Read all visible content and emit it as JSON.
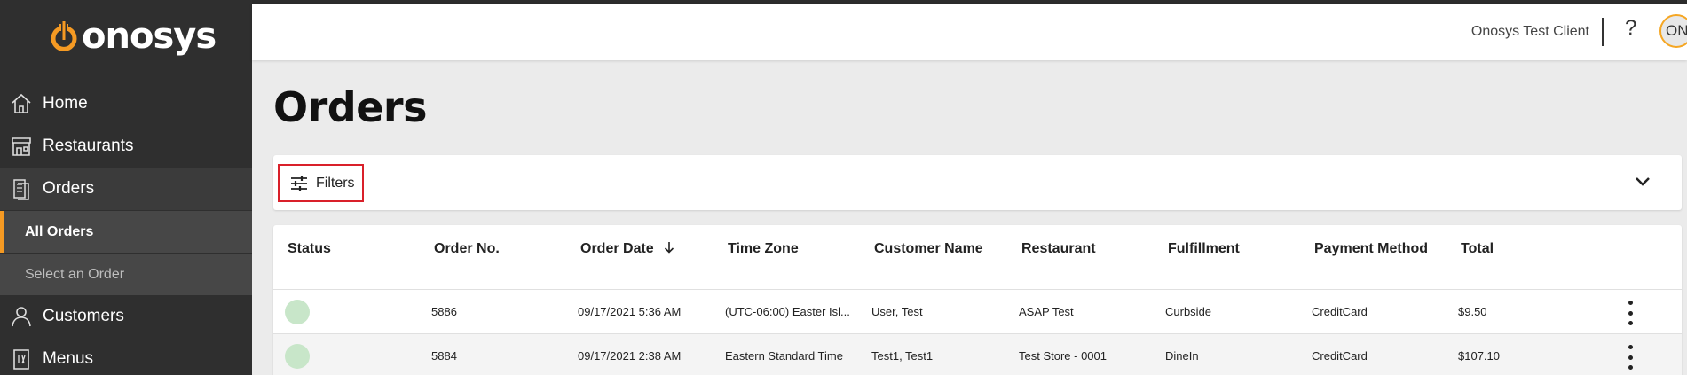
{
  "app": {
    "logo_text": "onosys",
    "brand_color": "#f59a23"
  },
  "sidebar": {
    "items": [
      {
        "label": "Home",
        "icon": "home-icon"
      },
      {
        "label": "Restaurants",
        "icon": "storefront-icon"
      },
      {
        "label": "Orders",
        "icon": "receipt-icon"
      },
      {
        "label": "Customers",
        "icon": "person-icon"
      },
      {
        "label": "Menus",
        "icon": "menu-card-icon"
      }
    ],
    "sub_items": [
      {
        "label": "All Orders"
      },
      {
        "label": "Select an Order"
      }
    ]
  },
  "header": {
    "client_name": "Onosys Test Client",
    "help_label": "?",
    "avatar_initials": "ON"
  },
  "main": {
    "title": "Orders",
    "filters_label": "Filters",
    "table": {
      "columns": [
        "Status",
        "Order No.",
        "Order Date",
        "Time Zone",
        "Customer Name",
        "Restaurant",
        "Fulfillment",
        "Payment Method",
        "Total"
      ],
      "sort_column": "Order Date",
      "sort_direction": "descending",
      "rows": [
        {
          "status_color": "#c8e6c9",
          "order_no": "5886",
          "order_date": "09/17/2021 5:36 AM",
          "time_zone": "(UTC-06:00) Easter Isl...",
          "customer_name": "User, Test",
          "restaurant": "ASAP Test",
          "fulfillment": "Curbside",
          "payment_method": "CreditCard",
          "total": "$9.50"
        },
        {
          "status_color": "#c8e6c9",
          "order_no": "5884",
          "order_date": "09/17/2021 2:38 AM",
          "time_zone": "Eastern Standard Time",
          "customer_name": "Test1, Test1",
          "restaurant": "Test Store - 0001",
          "fulfillment": "DineIn",
          "payment_method": "CreditCard",
          "total": "$107.10"
        }
      ]
    }
  }
}
